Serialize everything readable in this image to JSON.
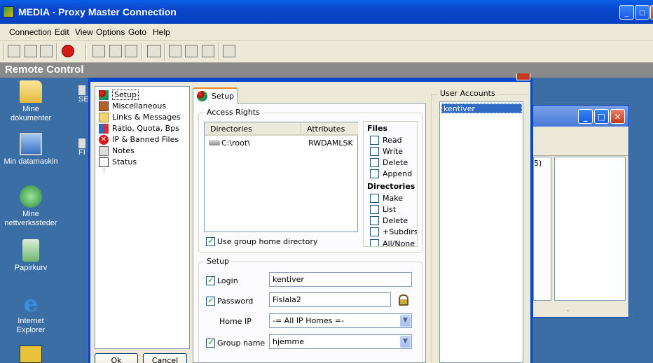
{
  "window": {
    "title": "MEDIA - Proxy Master Connection"
  },
  "menu": [
    "Connection",
    "Edit",
    "View",
    "Options",
    "Goto",
    "Help"
  ],
  "remote_label": "Remote Control",
  "desktop": [
    {
      "label1": "Mine",
      "label2": "dokumenter",
      "icon": "folder-documents-icon"
    },
    {
      "label1": "Min datamaskin",
      "label2": "",
      "icon": "computer-icon"
    },
    {
      "label1": "Mine",
      "label2": "nettverkssteder",
      "icon": "network-icon"
    },
    {
      "label1": "Papirkurv",
      "label2": "",
      "icon": "recycle-bin-icon"
    },
    {
      "label1": "Internet",
      "label2": "Explorer",
      "icon": "internet-explorer-icon"
    }
  ],
  "desktop_partial": [
    "SE",
    "FI"
  ],
  "tree": [
    {
      "label": "Setup",
      "icon": "setup-icon"
    },
    {
      "label": "Miscellaneous",
      "icon": "misc-icon"
    },
    {
      "label": "Links & Messages",
      "icon": "links-icon"
    },
    {
      "label": "Ratio, Quota, Bps",
      "icon": "ratio-icon"
    },
    {
      "label": "IP & Banned Files",
      "icon": "banned-icon"
    },
    {
      "label": "Notes",
      "icon": "notes-icon"
    },
    {
      "label": "Status",
      "icon": "status-icon"
    }
  ],
  "buttons": {
    "ok": "Ok",
    "cancel": "Cancel"
  },
  "tab": {
    "label": "Setup"
  },
  "access": {
    "title": "Access Rights",
    "col_dirs": "Directories",
    "col_attr": "Attributes",
    "row_dir": "C:\\root\\",
    "row_attr": "RWDAMLSK",
    "use_group_home": "Use group home directory"
  },
  "files": {
    "title": "Files",
    "items": [
      "Read",
      "Write",
      "Delete",
      "Append"
    ]
  },
  "directories": {
    "title": "Directories",
    "items": [
      "Make",
      "List",
      "Delete",
      "+Subdirs",
      "All/None"
    ]
  },
  "setup": {
    "title": "Setup",
    "login_label": "Login",
    "login_value": "kentiver",
    "password_label": "Password",
    "password_value": "Fislala2",
    "homeip_label": "Home IP",
    "homeip_value": "-= All IP Homes =-",
    "group_label": "Group name",
    "group_value": "hjemme"
  },
  "users": {
    "title": "User Accounts",
    "items": [
      "kentiver"
    ]
  },
  "bgwin": {
    "frag1": "5)",
    "frag2": "."
  }
}
